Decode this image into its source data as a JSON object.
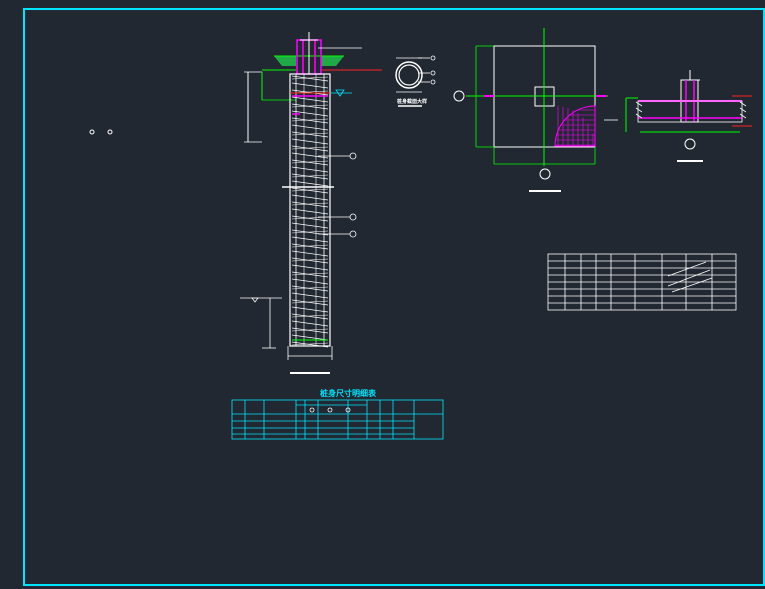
{
  "drawing": {
    "table_title": "桩身尺寸明细表",
    "section_label": "桩身截面大样",
    "colors": {
      "background": "#212831",
      "frame": "#00e5ff",
      "line": "#ffffff",
      "accent_magenta": "#ff00ff",
      "accent_green": "#00ff00",
      "accent_red": "#ff2020",
      "accent_cyan": "#00e5ff"
    }
  }
}
